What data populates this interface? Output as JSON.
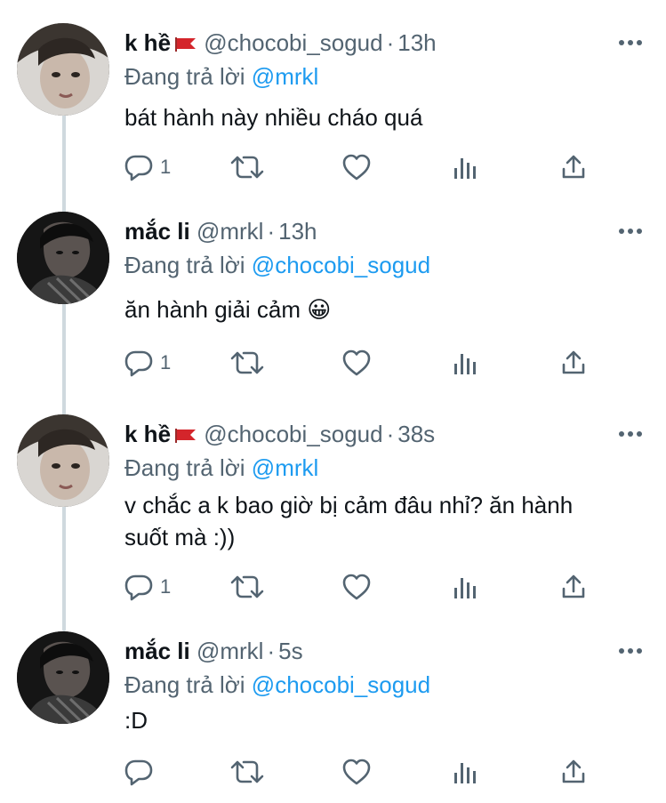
{
  "tweets": [
    {
      "name": "k hề",
      "has_flag": true,
      "handle": "@chocobi_sogud",
      "separator": "·",
      "time": "13h",
      "replying_label": "Đang trả lời",
      "replying_to": "@mrkl",
      "text_lines": [
        "bát hành này nhiều cháo quá"
      ],
      "reply_count": "1",
      "avatar_style": "light"
    },
    {
      "name": "mắc li",
      "has_flag": false,
      "handle": "@mrkl",
      "separator": "·",
      "time": "13h",
      "replying_label": "Đang trả lời",
      "replying_to": "@chocobi_sogud",
      "text_lines": [
        "ăn hành giải cảm 😀"
      ],
      "reply_count": "1",
      "avatar_style": "dark"
    },
    {
      "name": "k hề",
      "has_flag": true,
      "handle": "@chocobi_sogud",
      "separator": "·",
      "time": "38s",
      "replying_label": "Đang trả lời",
      "replying_to": "@mrkl",
      "text_lines": [
        "v chắc a k bao giờ bị cảm đâu nhỉ? ăn hành",
        "suốt mà :))"
      ],
      "reply_count": "1",
      "avatar_style": "light"
    },
    {
      "name": "mắc li",
      "has_flag": false,
      "handle": "@mrkl",
      "separator": "·",
      "time": "5s",
      "replying_label": "Đang trả lời",
      "replying_to": "@chocobi_sogud",
      "text_lines": [
        ":D"
      ],
      "reply_count": "",
      "avatar_style": "dark"
    }
  ],
  "icons": {
    "reply": "reply-icon",
    "retweet": "retweet-icon",
    "like": "heart-icon",
    "views": "views-icon",
    "share": "share-icon",
    "more": "more-icon",
    "flag": "red-flag-icon"
  },
  "colors": {
    "text": "#0f1419",
    "secondary": "#536471",
    "link": "#1d9bf0",
    "thread_line": "#cfd9de",
    "flag": "#d4252b"
  }
}
